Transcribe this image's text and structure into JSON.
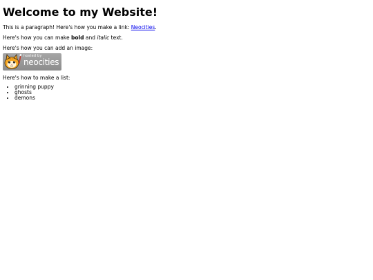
{
  "page": {
    "title": "Welcome to my Website!",
    "para1": {
      "text": "This is a paragraph! Here's how you make a link: ",
      "link": "Neocities",
      "after": "."
    },
    "para2": {
      "before": "Here's how you can make ",
      "bold": "bold",
      "middle": " and ",
      "italic": "italic",
      "after": " text."
    },
    "para3": "Here's how you can add an image:",
    "badge": {
      "small": "hosted by",
      "big": "neocities",
      "icon": "neocities-cat-icon"
    },
    "para4": "Here's how to make a list:",
    "list": [
      "grinning puppy",
      "ghosts",
      "demons"
    ]
  },
  "colors": {
    "link": "#0000ee",
    "badge_bg": "#999999",
    "text": "#000000"
  }
}
